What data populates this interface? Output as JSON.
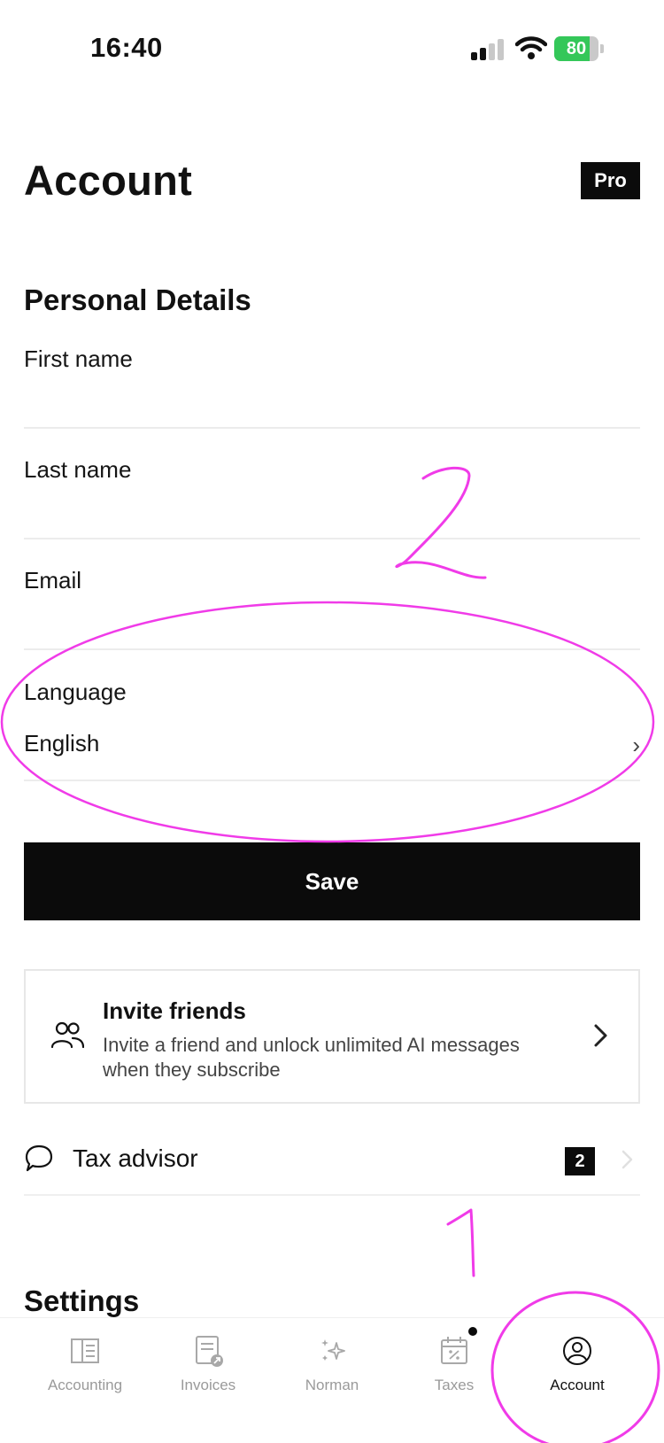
{
  "status_bar": {
    "time": "16:40",
    "battery_level": 80,
    "battery_text": "80"
  },
  "header": {
    "title": "Account",
    "plan_badge": "Pro"
  },
  "personal_details": {
    "title": "Personal Details",
    "first_name_label": "First name",
    "last_name_label": "Last name",
    "email_label": "Email",
    "language_label": "Language",
    "language_value": "English"
  },
  "save_label": "Save",
  "invite": {
    "title": "Invite friends",
    "description": "Invite a friend and unlock unlimited AI messages when they subscribe"
  },
  "tax_advisor": {
    "label": "Tax advisor",
    "count": "2"
  },
  "settings": {
    "title": "Settings"
  },
  "tabs": [
    {
      "label": "Accounting",
      "icon": "ledger-icon",
      "active": false
    },
    {
      "label": "Invoices",
      "icon": "invoice-icon",
      "active": false
    },
    {
      "label": "Norman",
      "icon": "sparkle-icon",
      "active": false
    },
    {
      "label": "Taxes",
      "icon": "calendar-percent-icon",
      "active": false,
      "badge_dot": true
    },
    {
      "label": "Account",
      "icon": "user-circle-icon",
      "active": true
    }
  ],
  "annotations": {
    "step_1": "1",
    "step_2": "2",
    "color": "#f03be8"
  },
  "colors": {
    "accent": "#0b0b0b",
    "battery": "#34c759",
    "muted": "#9a9a9a"
  }
}
